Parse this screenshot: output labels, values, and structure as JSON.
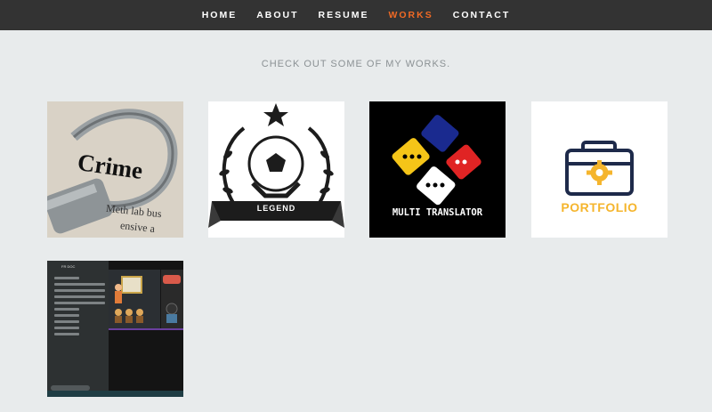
{
  "nav": {
    "items": [
      {
        "label": "HOME",
        "active": false
      },
      {
        "label": "ABOUT",
        "active": false
      },
      {
        "label": "RESUME",
        "active": false
      },
      {
        "label": "WORKS",
        "active": true
      },
      {
        "label": "CONTACT",
        "active": false
      }
    ],
    "active_color": "#f06a25"
  },
  "section": {
    "subtitle": "CHECK OUT SOME OF MY WORKS."
  },
  "works": {
    "crime": {
      "text": "Crime",
      "line1": "Meth lab bus",
      "line2": "ensive a"
    },
    "legend": {
      "text": "LEGEND"
    },
    "translator": {
      "text": "MULTI TRANSLATOR"
    },
    "portfolio": {
      "text": "PORTFOLIO"
    },
    "app": {
      "header": "FR DOC"
    }
  }
}
